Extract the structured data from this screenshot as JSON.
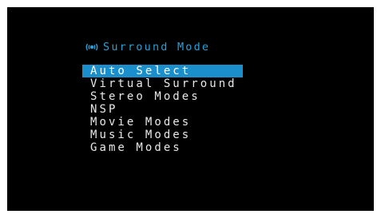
{
  "header": {
    "title": "Surround Mode",
    "icon": "speaker-icon",
    "accent_color": "#2a9fd6"
  },
  "menu": {
    "selected_index": 0,
    "highlight_color": "#1b8fcc",
    "items": [
      {
        "label": "Auto Select"
      },
      {
        "label": "Virtual Surround"
      },
      {
        "label": "Stereo Modes"
      },
      {
        "label": "NSP"
      },
      {
        "label": "Movie Modes"
      },
      {
        "label": "Music Modes"
      },
      {
        "label": "Game Modes"
      }
    ]
  }
}
